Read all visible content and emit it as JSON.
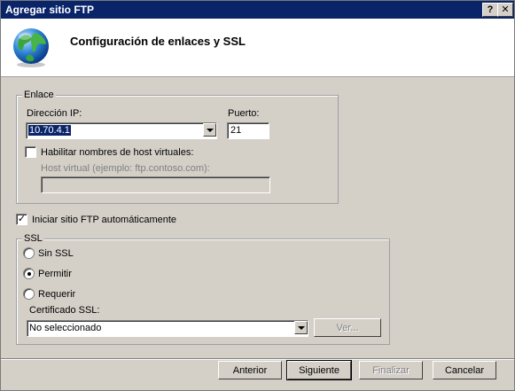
{
  "window": {
    "title": "Agregar sitio FTP",
    "help_label": "?",
    "close_label": "✕"
  },
  "header": {
    "title": "Configuración de enlaces y SSL",
    "icon": "globe-icon"
  },
  "binding": {
    "legend": "Enlace",
    "ip_label": "Dirección IP:",
    "ip_value": "10.70.4.1",
    "port_label": "Puerto:",
    "port_value": "21",
    "virtual_host_checkbox_label": "Habilitar nombres de host virtuales:",
    "virtual_host_checked": false,
    "virtual_host_label": "Host virtual (ejemplo: ftp.contoso.com):",
    "virtual_host_value": ""
  },
  "auto_start": {
    "label": "Iniciar sitio FTP automáticamente",
    "checked": true,
    "check_mark": "✓"
  },
  "ssl": {
    "legend": "SSL",
    "options": [
      {
        "label": "Sin SSL",
        "selected": false
      },
      {
        "label": "Permitir",
        "selected": true
      },
      {
        "label": "Requerir",
        "selected": false
      }
    ],
    "cert_label": "Certificado SSL:",
    "cert_value": "No seleccionado",
    "view_button": "Ver..."
  },
  "footer": {
    "back": "Anterior",
    "next": "Siguiente",
    "finish": "Finalizar",
    "cancel": "Cancelar"
  }
}
